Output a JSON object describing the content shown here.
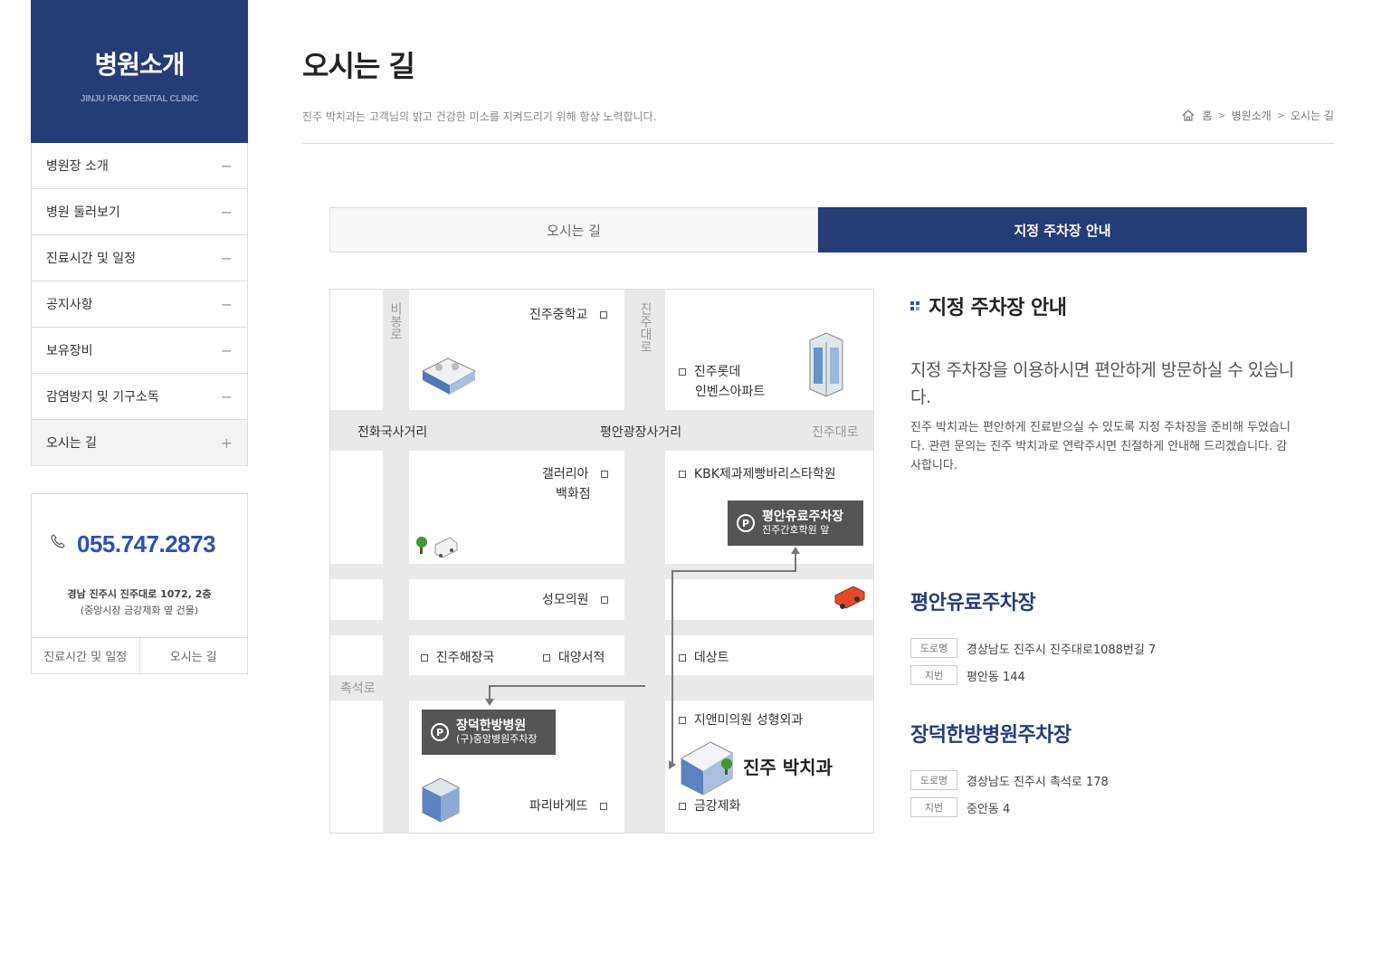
{
  "sidebar": {
    "title": "병원소개",
    "subtitle": "JINJU PARK DENTAL CLINIC",
    "items": [
      {
        "label": "병원장 소개",
        "sign": "−"
      },
      {
        "label": "병원 둘러보기",
        "sign": "−"
      },
      {
        "label": "진료시간 및 일정",
        "sign": "−"
      },
      {
        "label": "공지사항",
        "sign": "−"
      },
      {
        "label": "보유장비",
        "sign": "−"
      },
      {
        "label": "감염방지 및 기구소독",
        "sign": "−"
      },
      {
        "label": "오시는 길",
        "sign": "+"
      }
    ]
  },
  "contact": {
    "phone": "055.747.2873",
    "address": "경남 진주시 진주대로 1072, 2층",
    "address_note": "(중앙시장 금강제화 옆 건물)",
    "btn_hours": "진료시간 및 일정",
    "btn_directions": "오시는 길"
  },
  "header": {
    "title": "오시는 길",
    "description": "진주 박치과는 고객님의 밝고 건강한 미소를 지켜드리기 위해 항상 노력합니다.",
    "breadcrumb": [
      "홈",
      "병원소개",
      "오시는 길"
    ]
  },
  "tabs": [
    "오시는 길",
    "지정 주차장 안내"
  ],
  "map": {
    "roads": {
      "v_left": "비봉로",
      "v_mid": "진주대로",
      "h_left": "전화국사거리",
      "h_mid": "평안광장사거리",
      "h_right": "진주대로",
      "chokseok": "촉석로"
    },
    "places": {
      "middle_school": "진주중학교",
      "lotte_1": "진주롯데",
      "lotte_2": "인벤스아파트",
      "galleria_1": "갤러리아",
      "galleria_2": "백화점",
      "kbk": "KBK제과제빵바리스타학원",
      "seongmo": "성모의원",
      "haejang": "진주해장국",
      "daeyang": "대양서적",
      "desangt": "데상트",
      "jien": "지앤미의원 성형외과",
      "paris": "파리바게뜨",
      "geumgang": "금강제화",
      "clinic": "진주 박치과"
    },
    "parking_a": {
      "title": "평안유료주차장",
      "sub": "진주간호학원 앞",
      "p": "P"
    },
    "parking_b": {
      "title": "장덕한방병원",
      "sub": "(구)중앙병원주차장",
      "p": "P"
    }
  },
  "info": {
    "title": "지정 주차장 안내",
    "lead": "지정 주차장을 이용하시면 편안하게 방문하실 수 있습니다.",
    "body": "진주 박치과는 편안하게 진료받으실 수 있도록 지정 주차장을 준비해 두었습니다. 관련 문의는 진주 박치과로 연락주시면 친절하게 안내해 드리겠습니다. 감사합니다.",
    "lots": [
      {
        "name": "평안유료주차장",
        "road_tag": "도로명",
        "road": "경상남도 진주시 진주대로1088번길 7",
        "lot_tag": "지번",
        "lot": "평안동 144"
      },
      {
        "name": "장덕한방병원주차장",
        "road_tag": "도로명",
        "road": "경상남도 진주시 촉석로 178",
        "lot_tag": "지번",
        "lot": "중안동 4"
      }
    ]
  },
  "colors": {
    "navy": "#263c77",
    "phone_blue": "#2e4fb6",
    "map_road": "#e9e9e9",
    "parking_box": "#555555"
  }
}
